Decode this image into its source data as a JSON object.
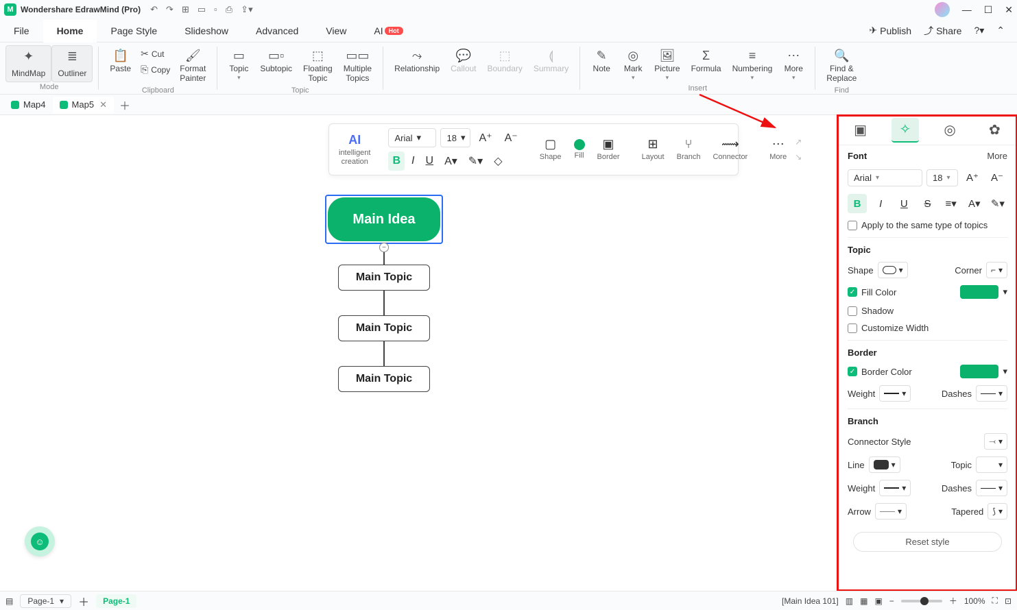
{
  "app": {
    "title": "Wondershare EdrawMind (Pro)"
  },
  "menus": {
    "file": "File",
    "home": "Home",
    "page_style": "Page Style",
    "slideshow": "Slideshow",
    "advanced": "Advanced",
    "view": "View",
    "ai": "AI",
    "ai_badge": "Hot"
  },
  "titlebar_right": {
    "publish": "Publish",
    "share": "Share"
  },
  "ribbon": {
    "mode": "Mode",
    "mindmap": "MindMap",
    "outliner": "Outliner",
    "clipboard": "Clipboard",
    "paste": "Paste",
    "cut": "Cut",
    "copy": "Copy",
    "format_painter": "Format\nPainter",
    "topic_group": "Topic",
    "topic": "Topic",
    "subtopic": "Subtopic",
    "floating": "Floating\nTopic",
    "multiple": "Multiple\nTopics",
    "relationship": "Relationship",
    "callout": "Callout",
    "boundary": "Boundary",
    "summary": "Summary",
    "insert": "Insert",
    "note": "Note",
    "mark": "Mark",
    "picture": "Picture",
    "formula": "Formula",
    "numbering": "Numbering",
    "more": "More",
    "find": "Find",
    "find_replace": "Find &\nReplace"
  },
  "tabs": {
    "map4": "Map4",
    "map5": "Map5"
  },
  "float": {
    "intelligent": "intelligent\ncreation",
    "font": "Arial",
    "size": "18",
    "shape": "Shape",
    "fill": "Fill",
    "border": "Border",
    "layout": "Layout",
    "branch": "Branch",
    "connector": "Connector",
    "more": "More"
  },
  "canvas": {
    "main_idea": "Main Idea",
    "main_topic": "Main Topic"
  },
  "side": {
    "font": "Font",
    "more": "More",
    "font_name": "Arial",
    "font_size": "18",
    "apply_same": "Apply to the same type of topics",
    "topic": "Topic",
    "shape": "Shape",
    "corner": "Corner",
    "fill_color": "Fill Color",
    "shadow": "Shadow",
    "custom_width": "Customize Width",
    "border": "Border",
    "border_color": "Border Color",
    "weight": "Weight",
    "dashes": "Dashes",
    "branch": "Branch",
    "connector_style": "Connector Style",
    "line": "Line",
    "topic2": "Topic",
    "arrow": "Arrow",
    "tapered": "Tapered",
    "reset": "Reset style"
  },
  "status": {
    "page_sel": "Page-1",
    "page_active": "Page-1",
    "selection": "[Main Idea 101]",
    "zoom": "100%"
  }
}
